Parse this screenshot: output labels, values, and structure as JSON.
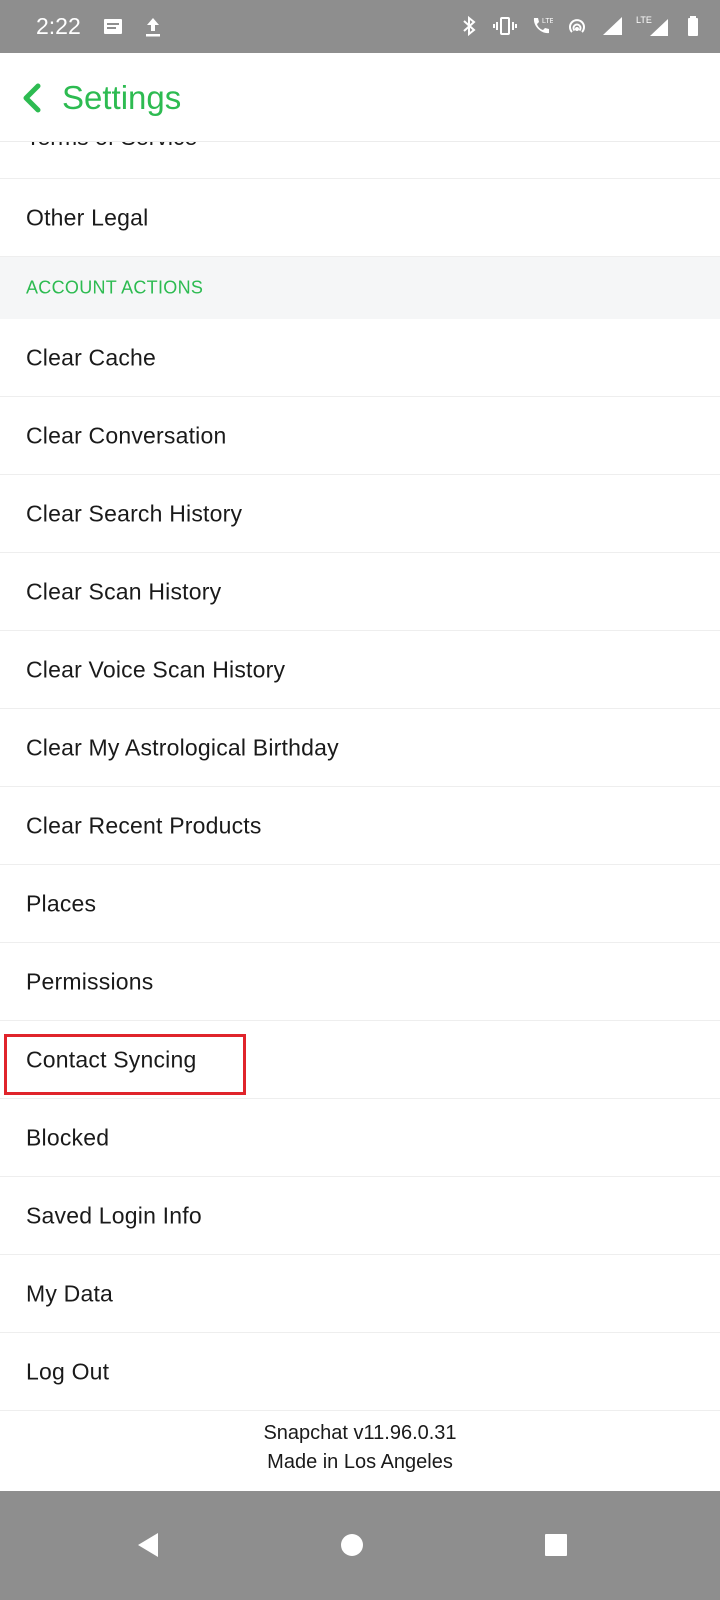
{
  "status_bar": {
    "time": "2:22",
    "left_icons": [
      "message-icon",
      "upload-icon"
    ],
    "right_icons": [
      "bluetooth-icon",
      "vibrate-icon",
      "volte-call-icon",
      "hotspot-icon",
      "signal-icon",
      "lte-signal-icon",
      "battery-icon"
    ],
    "lte_label": "LTE"
  },
  "header": {
    "title": "Settings",
    "accent_color": "#2dbb51"
  },
  "list": {
    "cut_item": "Terms of Service",
    "item_before_section": "Other Legal",
    "section_title": "ACCOUNT ACTIONS",
    "items": [
      "Clear Cache",
      "Clear Conversation",
      "Clear Search History",
      "Clear Scan History",
      "Clear Voice Scan History",
      "Clear My Astrological Birthday",
      "Clear Recent Products",
      "Places",
      "Permissions",
      "Contact Syncing",
      "Blocked",
      "Saved Login Info",
      "My Data",
      "Log Out"
    ],
    "highlighted_item": "Contact Syncing",
    "highlight_color": "#e0242b"
  },
  "footer": {
    "version": "Snapchat v11.96.0.31",
    "tagline": "Made in Los Angeles"
  },
  "nav_bar": {
    "buttons": [
      "back-triangle-icon",
      "home-circle-icon",
      "recents-square-icon"
    ]
  }
}
